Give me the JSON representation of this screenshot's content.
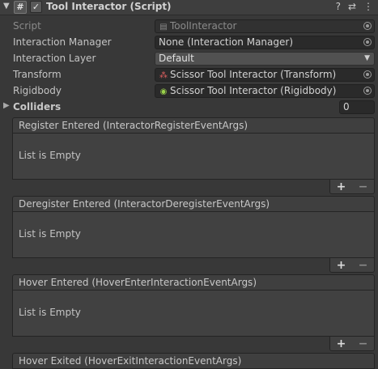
{
  "header": {
    "title": "Tool Interactor (Script)",
    "enabled": true,
    "icons": [
      "help-icon",
      "preset-icon",
      "menu-icon"
    ]
  },
  "props": {
    "script": {
      "label": "Script",
      "value": "ToolInteractor"
    },
    "interaction_manager": {
      "label": "Interaction Manager",
      "value": "None (Interaction Manager)"
    },
    "interaction_layer": {
      "label": "Interaction Layer",
      "value": "Default"
    },
    "transform": {
      "label": "Transform",
      "value": "Scissor Tool Interactor (Transform)"
    },
    "rigidbody": {
      "label": "Rigidbody",
      "value": "Scissor Tool Interactor (Rigidbody)"
    },
    "colliders": {
      "label": "Colliders",
      "size": "0"
    }
  },
  "events": [
    {
      "title": "Register Entered (InteractorRegisterEventArgs)",
      "empty_text": "List is Empty",
      "add": "+",
      "remove": "−"
    },
    {
      "title": "Deregister Entered (InteractorDeregisterEventArgs)",
      "empty_text": "List is Empty",
      "add": "+",
      "remove": "−"
    },
    {
      "title": "Hover Entered (HoverEnterInteractionEventArgs)",
      "empty_text": "List is Empty",
      "add": "+",
      "remove": "−"
    },
    {
      "title": "Hover Exited (HoverExitInteractionEventArgs)"
    }
  ]
}
